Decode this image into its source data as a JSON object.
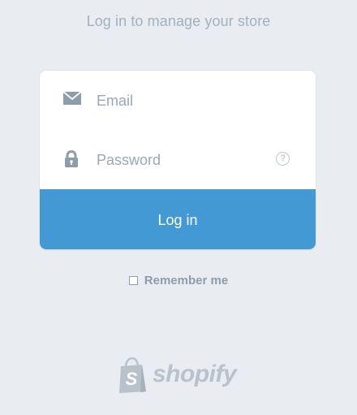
{
  "heading": "Log in to manage your store",
  "form": {
    "email_placeholder": "Email",
    "password_placeholder": "Password",
    "help_glyph": "?",
    "submit_label": "Log in"
  },
  "remember": {
    "label": "Remember me",
    "checked": false
  },
  "brand": {
    "wordmark": "shopify",
    "logo_icon": "shopify-bag-icon"
  },
  "icons": {
    "email": "envelope-icon",
    "password": "lock-icon",
    "help": "question-circle-icon"
  },
  "colors": {
    "background": "#e9ecf0",
    "button": "#4399d4",
    "muted_text": "#a3b1bf",
    "icon": "#8e9dac"
  }
}
